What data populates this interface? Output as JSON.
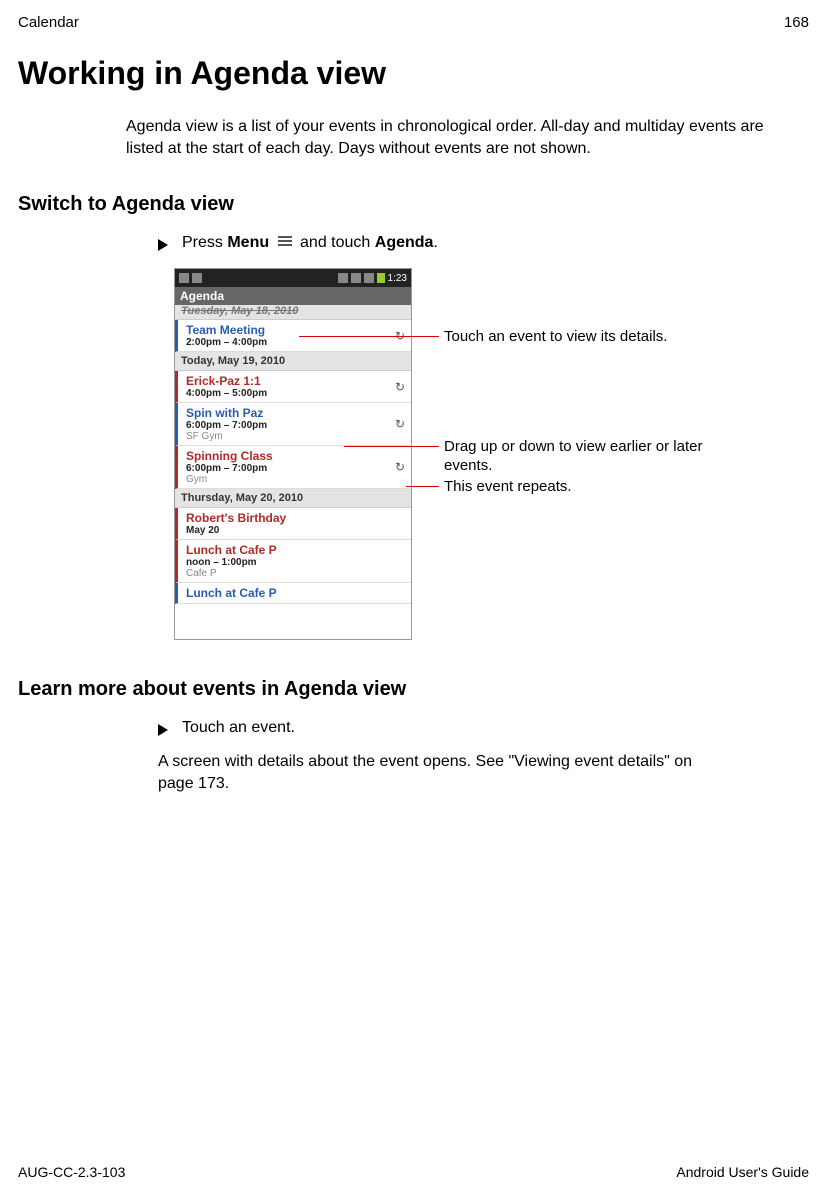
{
  "header": {
    "section": "Calendar",
    "page": "168"
  },
  "h1": "Working in Agenda view",
  "intro": "Agenda view is a list of your events in chronological order. All-day and multiday events are listed at the start of each day. Days without events are not shown.",
  "h2a": "Switch to Agenda view",
  "step1": {
    "pre": "Press ",
    "menu": "Menu",
    "mid": " and touch ",
    "agenda": "Agenda",
    "post": "."
  },
  "phone": {
    "time": "1:23",
    "agenda_label": "Agenda",
    "day_cut": "Tuesday, May 18, 2010",
    "events": [
      {
        "day": null,
        "title": "Team Meeting",
        "time": "2:00pm – 4:00pm",
        "loc": "",
        "color": "blue",
        "repeat": true
      },
      {
        "day": "Today, May 19, 2010"
      },
      {
        "title": "Erick-Paz 1:1",
        "time": "4:00pm – 5:00pm",
        "loc": "",
        "color": "red",
        "repeat": true
      },
      {
        "title": "Spin with Paz",
        "time": "6:00pm – 7:00pm",
        "loc": "SF Gym",
        "color": "blue",
        "repeat": true
      },
      {
        "title": "Spinning Class",
        "time": "6:00pm – 7:00pm",
        "loc": "Gym",
        "color": "red",
        "repeat": true
      },
      {
        "day": "Thursday, May 20, 2010"
      },
      {
        "title": "Robert's Birthday",
        "time": "May 20",
        "loc": "",
        "color": "red",
        "repeat": false
      },
      {
        "title": "Lunch at Cafe P",
        "time": "noon – 1:00pm",
        "loc": "Cafe P",
        "color": "red",
        "repeat": false
      },
      {
        "title": "Lunch at Cafe P",
        "time": "",
        "loc": "",
        "color": "blue",
        "repeat": false
      }
    ]
  },
  "callouts": {
    "c1": "Touch an event to view its details.",
    "c2": "Drag up or down to view earlier or later events.",
    "c3": "This event repeats."
  },
  "h2b": "Learn more about events in Agenda view",
  "step2": "Touch an event.",
  "para2": "A screen with details about the event opens. See \"Viewing event details\" on page 173.",
  "footer": {
    "left": "AUG-CC-2.3-103",
    "right": "Android User's Guide"
  }
}
